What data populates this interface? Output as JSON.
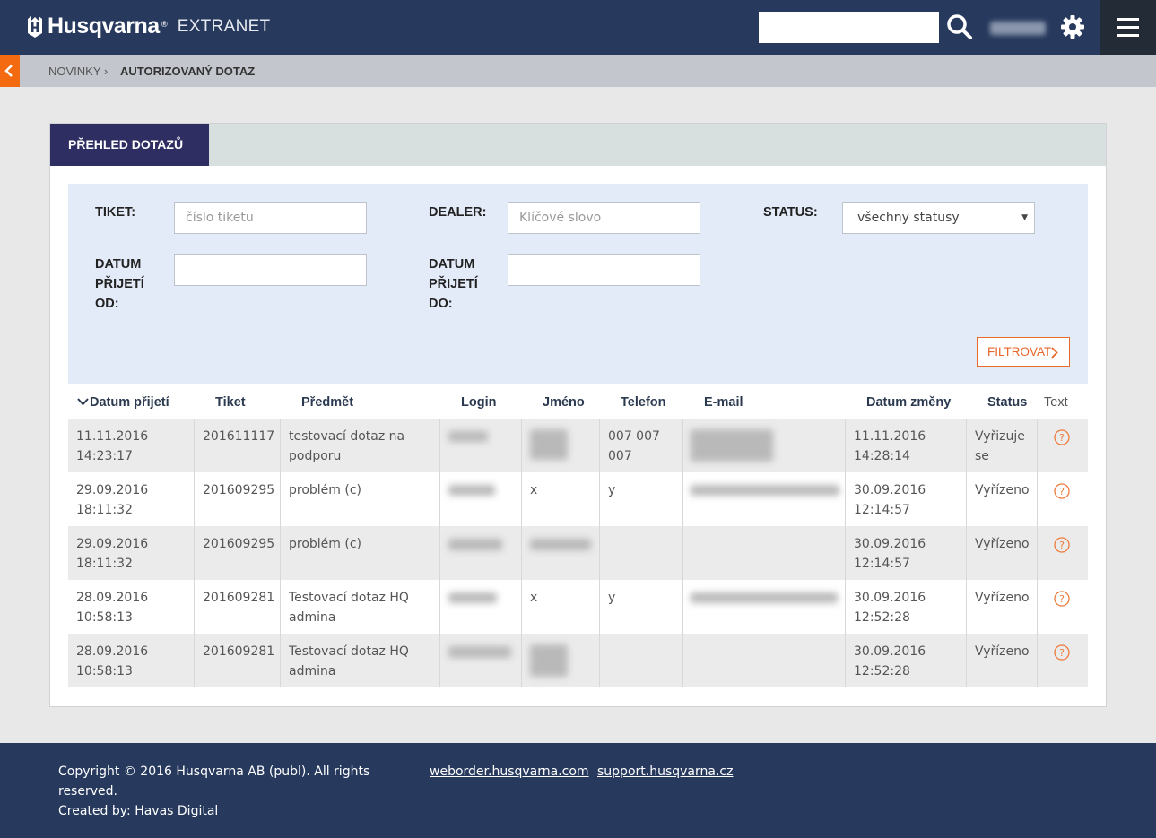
{
  "header": {
    "brand": "Husqvarna",
    "brand_reg": "®",
    "product": "EXTRANET",
    "search": {
      "value": "",
      "placeholder": ""
    },
    "icons": {
      "search": "search-icon",
      "settings": "gear-icon",
      "menu": "hamburger-menu-icon",
      "back": "chevron-left-icon"
    }
  },
  "breadcrumb": {
    "items": [
      "NOVINKY",
      "AUTORIZOVANÝ DOTAZ"
    ],
    "separator": "›"
  },
  "panel": {
    "tab_label": "PŘEHLED DOTAZŮ",
    "filters": {
      "ticket": {
        "label": "TIKET:",
        "placeholder": "číslo tiketu",
        "value": ""
      },
      "dealer": {
        "label": "DEALER:",
        "placeholder": "Klíčové slovo",
        "value": ""
      },
      "status": {
        "label": "STATUS:",
        "selected": "všechny statusy"
      },
      "date_from": {
        "label_lines": [
          "DATUM",
          "PŘIJETÍ",
          "OD:"
        ],
        "value": ""
      },
      "date_to": {
        "label_lines": [
          "DATUM",
          "PŘIJETÍ",
          "DO:"
        ],
        "value": ""
      },
      "submit_label": "FILTROVAT"
    },
    "table": {
      "columns": [
        "Datum přijetí",
        "Tiket",
        "Předmět",
        "Login",
        "Jméno",
        "Telefon",
        "E-mail",
        "Datum změny",
        "Status",
        "Text"
      ],
      "sort_indicator": "chevron-down-icon",
      "rows": [
        {
          "received": [
            "11.11.2016",
            "14:23:17"
          ],
          "ticket": "201611117",
          "subject": [
            "testovací dotaz na",
            "podporu"
          ],
          "name": "",
          "phone": [
            "007 007",
            "007"
          ],
          "changed": [
            "11.11.2016",
            "14:28:14"
          ],
          "status": [
            "Vyřizuje",
            "se"
          ]
        },
        {
          "received": [
            "29.09.2016",
            "18:11:32"
          ],
          "ticket": "201609295",
          "subject": [
            "problém (c)"
          ],
          "name": "x",
          "phone": [
            "y"
          ],
          "changed": [
            "30.09.2016",
            "12:14:57"
          ],
          "status": [
            "Vyřízeno"
          ]
        },
        {
          "received": [
            "29.09.2016",
            "18:11:32"
          ],
          "ticket": "201609295",
          "subject": [
            "problém (c)"
          ],
          "name": "",
          "phone": [],
          "changed": [
            "30.09.2016",
            "12:14:57"
          ],
          "status": [
            "Vyřízeno"
          ]
        },
        {
          "received": [
            "28.09.2016",
            "10:58:13"
          ],
          "ticket": "201609281",
          "subject": [
            "Testovací dotaz HQ",
            "admina"
          ],
          "name": "x",
          "phone": [
            "y"
          ],
          "changed": [
            "30.09.2016",
            "12:52:28"
          ],
          "status": [
            "Vyřízeno"
          ]
        },
        {
          "received": [
            "28.09.2016",
            "10:58:13"
          ],
          "ticket": "201609281",
          "subject": [
            "Testovací dotaz HQ",
            "admina"
          ],
          "name": "",
          "phone": [],
          "changed": [
            "30.09.2016",
            "12:52:28"
          ],
          "status": [
            "Vyřízeno"
          ]
        }
      ]
    }
  },
  "footer": {
    "copyright_lines": [
      "Copyright © 2016 Husqvarna AB (publ). All rights",
      "reserved."
    ],
    "created_by": "Created by:",
    "created_by_link": "Havas Digital",
    "links": [
      "weborder.husqvarna.com",
      "support.husqvarna.cz"
    ]
  },
  "colors": {
    "header_bg": "#273a5e",
    "accent": "#f36a10",
    "tab_active": "#2f2e63",
    "filter_bg": "#e4ebf8"
  }
}
